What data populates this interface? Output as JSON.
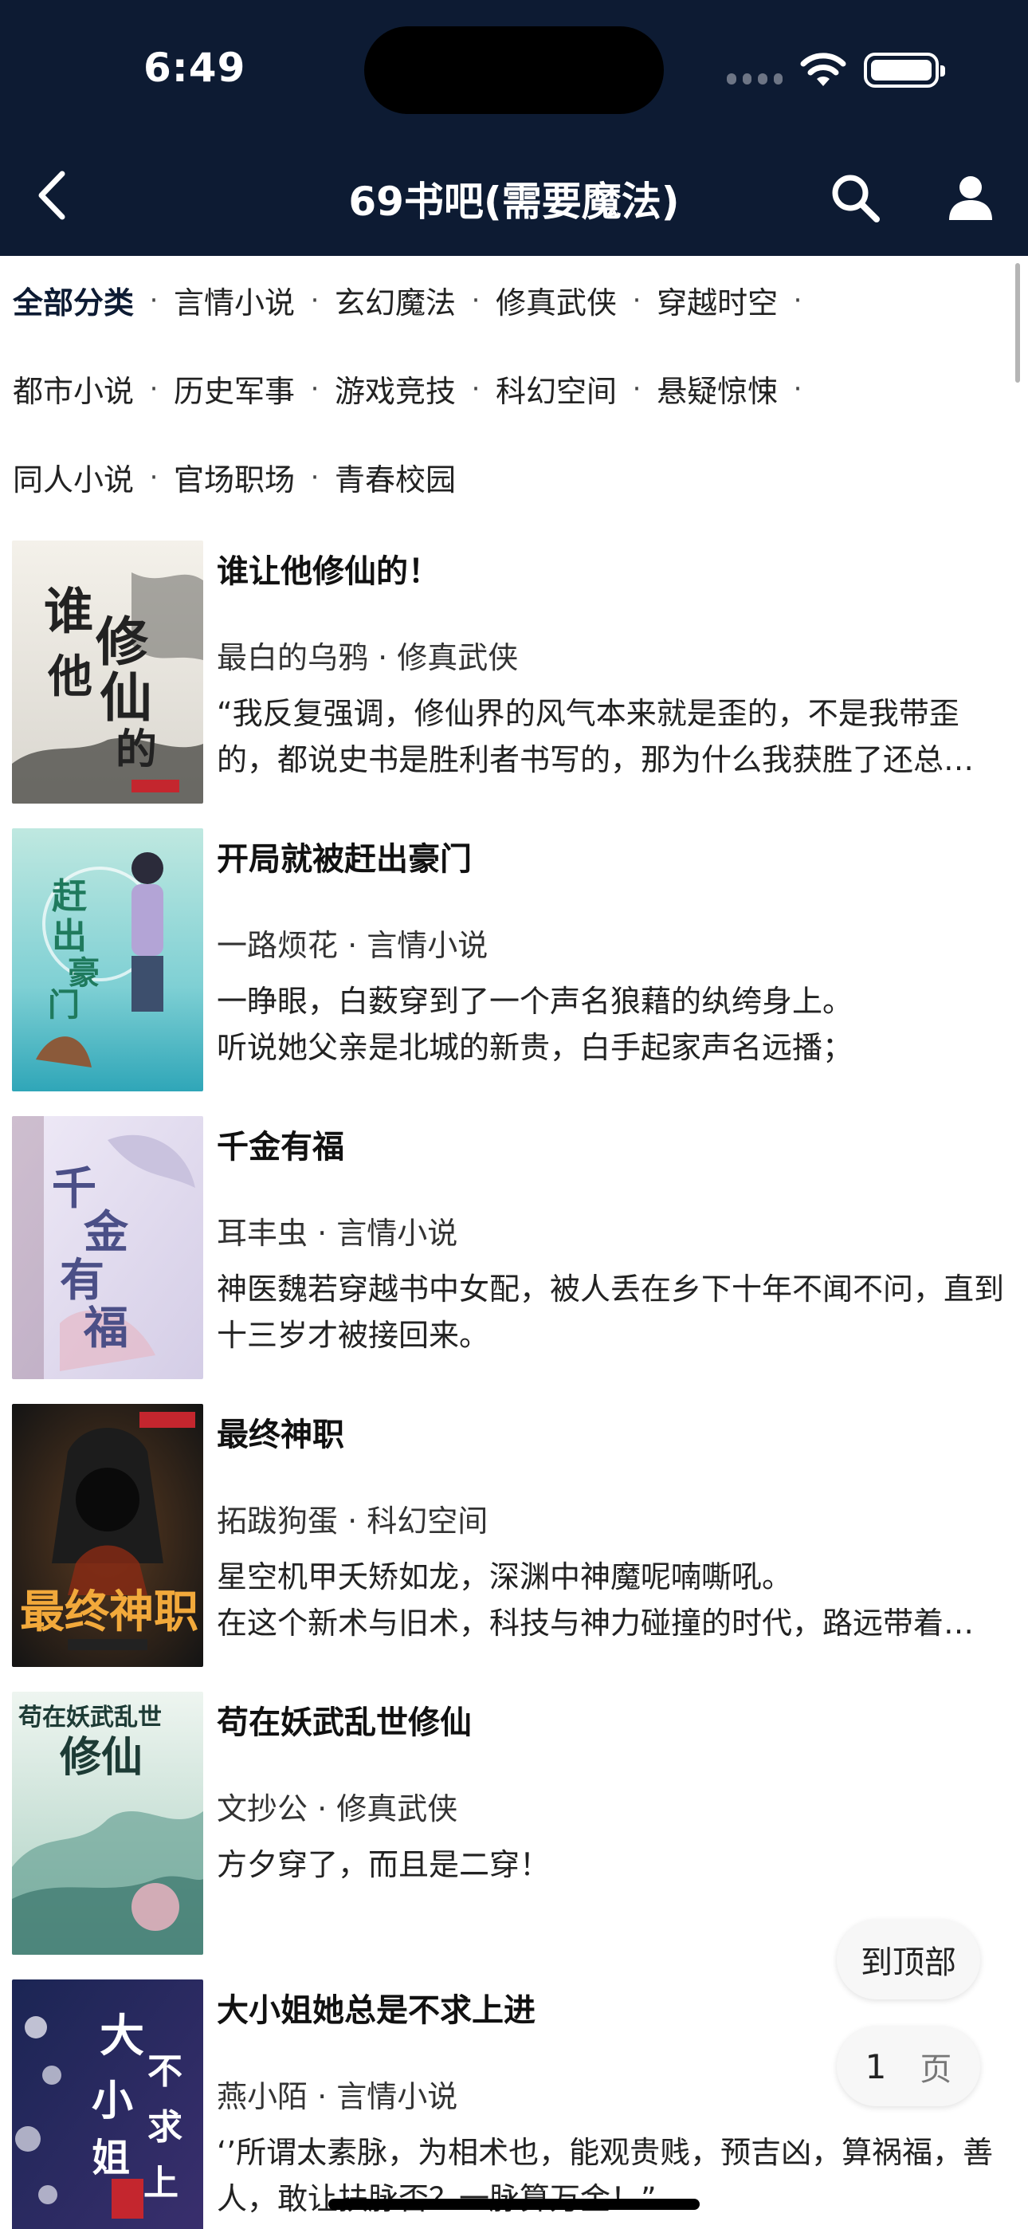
{
  "status_bar": {
    "time": "6:49"
  },
  "nav": {
    "title": "69书吧(需要魔法)"
  },
  "categories": [
    [
      "全部分类",
      "言情小说",
      "玄幻魔法",
      "修真武侠",
      "穿越时空"
    ],
    [
      "都市小说",
      "历史军事",
      "游戏竞技",
      "科幻空间",
      "悬疑惊悚"
    ],
    [
      "同人小说",
      "官场职场",
      "青春校园"
    ]
  ],
  "category_separator": "·",
  "books": [
    {
      "title": "谁让他修仙的！",
      "meta": "最白的乌鸦 · 修真武侠",
      "desc": "“我反复强调，修仙界的风气本来就是歪的，不是我带歪的，都说史书是胜利者书写的，那为什么我获胜了还总…",
      "cover_text": "谁让他修仙的"
    },
    {
      "title": "开局就被赶出豪门",
      "meta": "一路烦花 · 言情小说",
      "desc": "一睁眼，白薮穿到了一个声名狼藉的纨绔身上。\n听说她父亲是北城的新贵，白手起家声名远播；",
      "cover_text": "赶出豪门"
    },
    {
      "title": "千金有福",
      "meta": "耳丰虫 · 言情小说",
      "desc": "神医魏若穿越书中女配，被人丢在乡下十年不闻不问，直到十三岁才被接回来。",
      "cover_text": "千金有福"
    },
    {
      "title": "最终神职",
      "meta": "拓跋狗蛋 · 科幻空间",
      "desc": "星空机甲夭矫如龙，深渊中神魔呢喃嘶吼。\n在这个新术与旧术，科技与神力碰撞的时代，路远带着…",
      "cover_text": "最终神职"
    },
    {
      "title": "苟在妖武乱世修仙",
      "meta": "文抄公 · 修真武侠",
      "desc": "方夕穿了，而且是二穿！",
      "cover_text": "苟在妖武乱世修仙"
    },
    {
      "title": "大小姐她总是不求上进",
      "meta": "燕小陌 · 言情小说",
      "desc": "‘’所谓太素脉，为相术也，能观贵贱，预吉凶，算祸福，善人，敢让扶脉否？一脉算万金！”",
      "cover_text": "大小姐她总是不求上进"
    }
  ],
  "floating": {
    "to_top": "到顶部",
    "page_number": "1",
    "page_unit": "页"
  },
  "colors": {
    "nav_bg": "#0d1b33",
    "accent": "#0d1b33"
  }
}
